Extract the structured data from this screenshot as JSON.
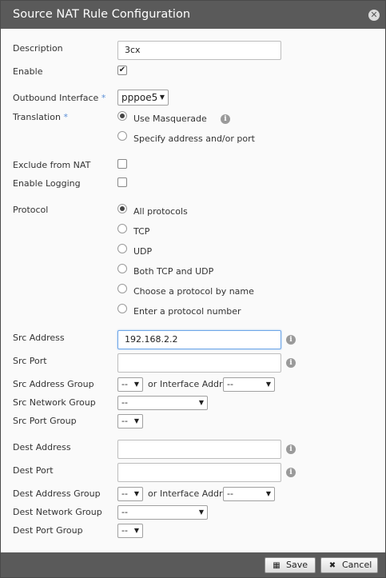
{
  "dialog": {
    "title": "Source NAT Rule Configuration",
    "close_glyph": "✕"
  },
  "form": {
    "description": {
      "label": "Description",
      "value": "3cx"
    },
    "enable": {
      "label": "Enable",
      "checked": true,
      "check_glyph": "✔"
    },
    "outbound_interface": {
      "label": "Outbound Interface",
      "required_mark": "*",
      "value": "pppoe5"
    },
    "translation": {
      "label": "Translation",
      "required_mark": "*",
      "options": [
        "Use Masquerade",
        "Specify address and/or port"
      ],
      "selected": "Use Masquerade"
    },
    "exclude_from_nat": {
      "label": "Exclude from NAT",
      "checked": false
    },
    "enable_logging": {
      "label": "Enable Logging",
      "checked": false
    },
    "protocol": {
      "label": "Protocol",
      "options": [
        "All protocols",
        "TCP",
        "UDP",
        "Both TCP and UDP",
        "Choose a protocol by name",
        "Enter a protocol number"
      ],
      "selected": "All protocols"
    },
    "src_address": {
      "label": "Src Address",
      "value": "192.168.2.2"
    },
    "src_port": {
      "label": "Src Port",
      "value": ""
    },
    "src_address_group": {
      "label": "Src Address Group",
      "value": "--",
      "or_text": "or",
      "iface_label": "Interface Addr",
      "iface_value": "--"
    },
    "src_network_group": {
      "label": "Src Network Group",
      "value": "--"
    },
    "src_port_group": {
      "label": "Src Port Group",
      "value": "--"
    },
    "dest_address": {
      "label": "Dest Address",
      "value": ""
    },
    "dest_port": {
      "label": "Dest Port",
      "value": ""
    },
    "dest_address_group": {
      "label": "Dest Address Group",
      "value": "--",
      "or_text": "or",
      "iface_label": "Interface Addr",
      "iface_value": "--"
    },
    "dest_network_group": {
      "label": "Dest Network Group",
      "value": "--"
    },
    "dest_port_group": {
      "label": "Dest Port Group",
      "value": "--"
    }
  },
  "icons": {
    "info": "i",
    "dropdown_arrow": "▼",
    "save": "floppy-disk-icon",
    "cancel": "x-icon"
  },
  "footer": {
    "save_label": "Save",
    "cancel_label": "Cancel",
    "save_glyph": "💾",
    "cancel_glyph": "✖"
  },
  "colors": {
    "titlebar": "#5a5a5a",
    "required": "#5b8fd6",
    "focus": "#6ea6e8"
  }
}
